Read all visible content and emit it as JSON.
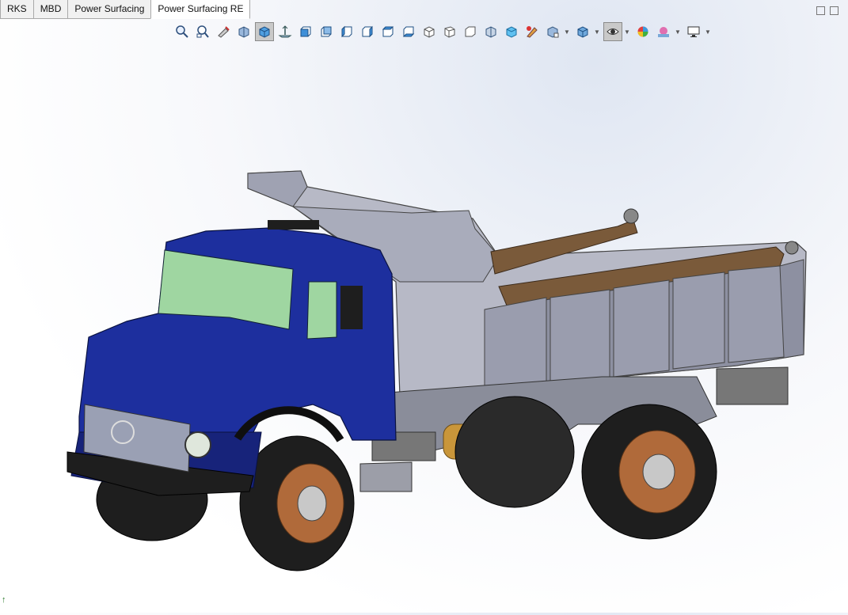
{
  "tabs": [
    {
      "label": "RKS",
      "active": false
    },
    {
      "label": "MBD",
      "active": false
    },
    {
      "label": "Power Surfacing",
      "active": false
    },
    {
      "label": "Power Surfacing RE",
      "active": true
    }
  ],
  "toolbar": {
    "icons": [
      "zoom-to-fit-icon",
      "zoom-to-area-icon",
      "previous-view-icon",
      "section-view-icon",
      "view-orientation-icon",
      "normal-to-icon",
      "front-view-icon",
      "back-view-icon",
      "left-view-icon",
      "right-view-icon",
      "top-view-icon",
      "bottom-view-icon",
      "isometric-view-icon",
      "trimetric-view-icon",
      "dimetric-view-icon",
      "wireframe-icon",
      "hidden-lines-icon",
      "shaded-icon",
      "edit-appearance-icon",
      "display-style-icon",
      "hide-show-items-icon",
      "scene-icon",
      "monitor-icon"
    ]
  },
  "viewport": {
    "model": "Dump truck assembly",
    "colors": {
      "cab": "#1d2f9e",
      "body": "#b7b9c6",
      "body_dark": "#8d90a1",
      "wood": "#7a5a3a",
      "tire": "#1e1e1e",
      "rim": "#b06a3a",
      "glass": "#9fd6a1",
      "tank": "#c9963a"
    }
  }
}
